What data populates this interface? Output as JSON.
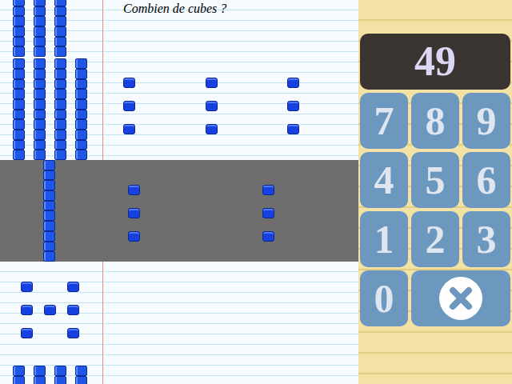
{
  "question": "Combien de cubes ?",
  "display": "49",
  "keys": [
    {
      "label": "7",
      "kind": "digit"
    },
    {
      "label": "8",
      "kind": "digit"
    },
    {
      "label": "9",
      "kind": "digit"
    },
    {
      "label": "4",
      "kind": "digit"
    },
    {
      "label": "5",
      "kind": "digit"
    },
    {
      "label": "6",
      "kind": "digit"
    },
    {
      "label": "1",
      "kind": "digit"
    },
    {
      "label": "2",
      "kind": "digit"
    },
    {
      "label": "3",
      "kind": "digit"
    },
    {
      "label": "0",
      "kind": "digit"
    },
    {
      "kind": "clear"
    }
  ],
  "rows": [
    {
      "kind": "side",
      "rod_lines": [
        3,
        4
      ],
      "ones": 9,
      "ones_layout": "grid",
      "selected": false
    },
    {
      "kind": "side",
      "rod_lines": [
        1
      ],
      "ones": 6,
      "ones_layout": "pairs",
      "selected": true
    },
    {
      "kind": "stacked",
      "rod_lines": [
        4
      ],
      "ones": 7,
      "ones_layout": "dice",
      "selected": false
    }
  ]
}
